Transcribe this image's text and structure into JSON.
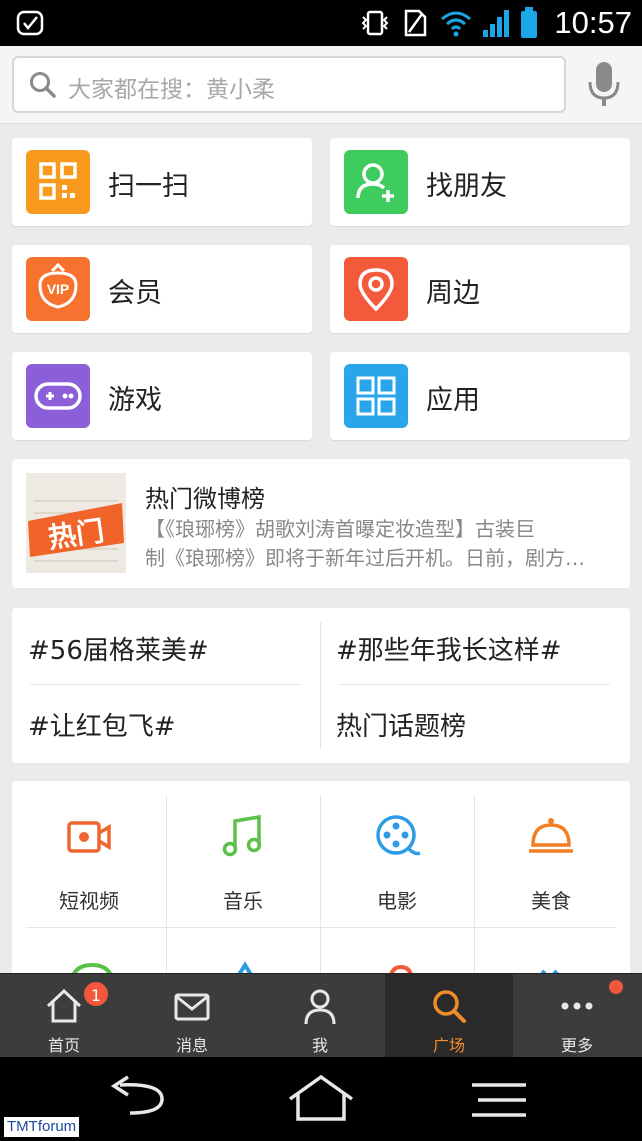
{
  "status": {
    "time": "10:57"
  },
  "search": {
    "placeholder": "大家都在搜：黄小柔"
  },
  "tiles": [
    {
      "label": "扫一扫",
      "icon": "qr-scan-icon",
      "color": "#f79a1e"
    },
    {
      "label": "找朋友",
      "icon": "add-friend-icon",
      "color": "#3fcc5e"
    },
    {
      "label": "会员",
      "icon": "vip-icon",
      "color": "#f7722f"
    },
    {
      "label": "周边",
      "icon": "location-pin-icon",
      "color": "#f25a3b"
    },
    {
      "label": "游戏",
      "icon": "gamepad-icon",
      "color": "#8a5fd8"
    },
    {
      "label": "应用",
      "icon": "apps-grid-icon",
      "color": "#27a6ec"
    }
  ],
  "hot": {
    "image_text": "热门",
    "title": "热门微博榜",
    "desc_line1": "【《琅琊榜》胡歌刘涛首曝定妆造型】古装巨",
    "desc_line2": "制《琅琊榜》即将于新年过后开机。日前，剧方…"
  },
  "topics": [
    "#56届格莱美#",
    "#那些年我长这样#",
    "#让红包飞#",
    "热门话题榜"
  ],
  "categories": [
    {
      "label": "短视频",
      "icon": "video-camera-icon",
      "color": "#f0652f"
    },
    {
      "label": "音乐",
      "icon": "music-note-icon",
      "color": "#5bc14a"
    },
    {
      "label": "电影",
      "icon": "film-reel-icon",
      "color": "#2d9be6"
    },
    {
      "label": "美食",
      "icon": "food-cloche-icon",
      "color": "#f27f24"
    }
  ],
  "tabs": [
    {
      "label": "首页",
      "icon": "home-icon",
      "badge": "1"
    },
    {
      "label": "消息",
      "icon": "mail-icon"
    },
    {
      "label": "我",
      "icon": "user-icon"
    },
    {
      "label": "广场",
      "icon": "search-icon",
      "active": true
    },
    {
      "label": "更多",
      "icon": "more-dots-icon",
      "dot": true
    }
  ],
  "watermark": {
    "brand_a": "TMT",
    "brand_b": "forum"
  },
  "colors": {
    "accent": "#f08d2b",
    "badge": "#f0573b",
    "tabbar": "#3c3c3c"
  }
}
